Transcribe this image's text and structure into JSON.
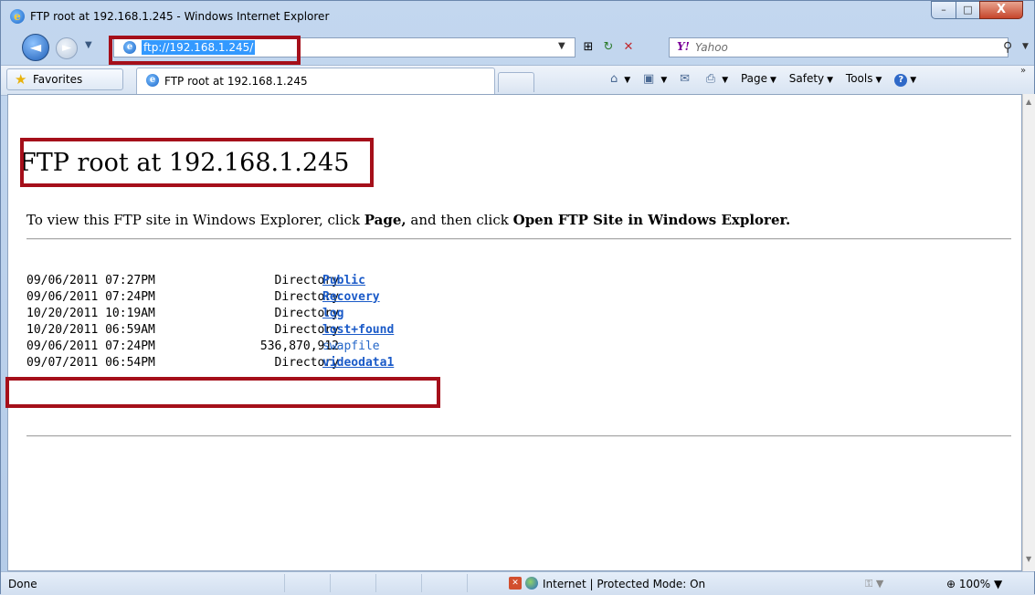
{
  "window": {
    "title": "FTP root at 192.168.1.245 - Windows Internet Explorer",
    "controls": {
      "minimize": "–",
      "maximize": "□",
      "close": "X"
    }
  },
  "nav": {
    "address": "ftp://192.168.1.245/",
    "search_provider": "Yahoo"
  },
  "commandbar": {
    "favorites_label": "Favorites",
    "tab_label": "FTP root at 192.168.1.245",
    "page_label": "Page",
    "safety_label": "Safety",
    "tools_label": "Tools"
  },
  "page": {
    "title": "FTP root at 192.168.1.245",
    "instruction": {
      "part1": "To view this FTP site in Windows Explorer, click ",
      "bold1": "Page,",
      "part2": " and then click ",
      "bold2": "Open FTP Site in Windows Explorer."
    },
    "entries": [
      {
        "date": "09/06/2011 07:27PM",
        "size": "Directory",
        "name": "Public"
      },
      {
        "date": "09/06/2011 07:24PM",
        "size": "Directory",
        "name": "Recovery"
      },
      {
        "date": "10/20/2011 10:19AM",
        "size": "Directory",
        "name": "log"
      },
      {
        "date": "10/20/2011 06:59AM",
        "size": "Directory",
        "name": "lost+found"
      },
      {
        "date": "09/06/2011 07:24PM",
        "size": "536,870,912",
        "name": "swapfile"
      },
      {
        "date": "09/07/2011 06:54PM",
        "size": "Directory",
        "name": "videodata1"
      }
    ]
  },
  "statusbar": {
    "status": "Done",
    "zone": "Internet | Protected Mode: On",
    "zoom": "100%"
  },
  "colors": {
    "highlight": "#a50f1a",
    "link": "#1a5ac8"
  }
}
